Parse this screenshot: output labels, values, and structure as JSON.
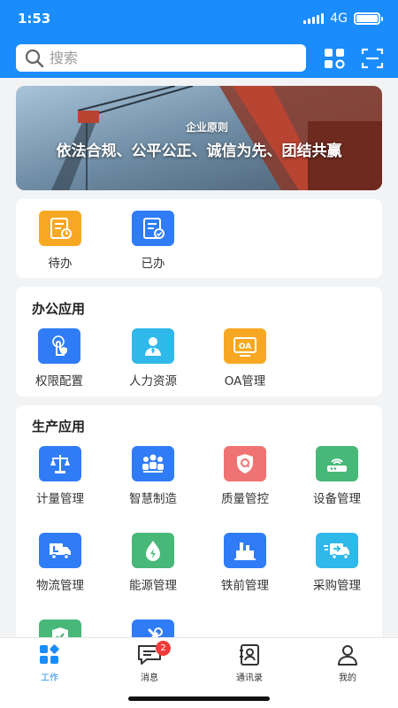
{
  "status_bar": {
    "time": "1:53",
    "network": "4G"
  },
  "search": {
    "placeholder": "搜索"
  },
  "banner": {
    "subtitle": "企业原则",
    "title": "依法合规、公平公正、诚信为先、团结共赢"
  },
  "tasks": {
    "items": [
      {
        "label": "待办",
        "icon": "todo-icon",
        "color": "#f7a823"
      },
      {
        "label": "已办",
        "icon": "done-icon",
        "color": "#2f7cf6"
      }
    ]
  },
  "office": {
    "title": "办公应用",
    "items": [
      {
        "label": "权限配置",
        "icon": "permission-icon",
        "color": "#2f7cf6"
      },
      {
        "label": "人力资源",
        "icon": "hr-icon",
        "color": "#2fb8ea"
      },
      {
        "label": "OA管理",
        "icon": "oa-icon",
        "color": "#f7a823"
      }
    ]
  },
  "production": {
    "title": "生产应用",
    "items": [
      {
        "label": "计量管理",
        "icon": "scale-icon",
        "color": "#2f7cf6"
      },
      {
        "label": "智慧制造",
        "icon": "team-icon",
        "color": "#2f7cf6"
      },
      {
        "label": "质量管控",
        "icon": "quality-icon",
        "color": "#f07373"
      },
      {
        "label": "设备管理",
        "icon": "router-icon",
        "color": "#47b878"
      },
      {
        "label": "物流管理",
        "icon": "truck-icon",
        "color": "#2f7cf6"
      },
      {
        "label": "能源管理",
        "icon": "energy-icon",
        "color": "#47b878"
      },
      {
        "label": "铁前管理",
        "icon": "factory-icon",
        "color": "#2f7cf6"
      },
      {
        "label": "采购管理",
        "icon": "delivery-icon",
        "color": "#2fb8ea"
      },
      {
        "label": "",
        "icon": "shield-check-icon",
        "color": "#47b878"
      },
      {
        "label": "",
        "icon": "tools-icon",
        "color": "#2f7cf6"
      }
    ]
  },
  "tabbar": {
    "items": [
      {
        "label": "工作",
        "icon": "work-icon",
        "active": true
      },
      {
        "label": "消息",
        "icon": "message-icon",
        "badge": "2"
      },
      {
        "label": "通讯录",
        "icon": "contacts-icon"
      },
      {
        "label": "我的",
        "icon": "profile-icon"
      }
    ]
  },
  "colors": {
    "primary": "#1a8cfb",
    "badge": "#f23b3b"
  }
}
